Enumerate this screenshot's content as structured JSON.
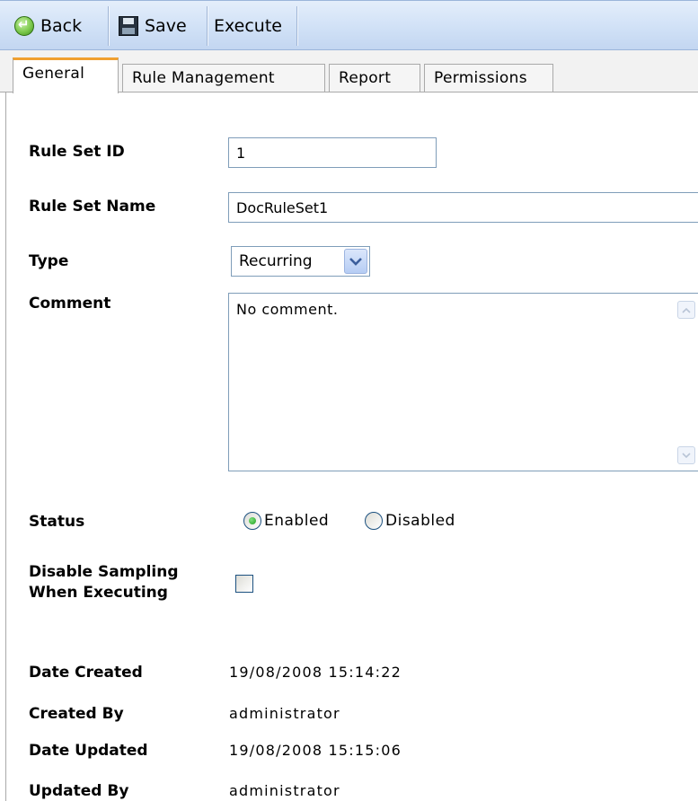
{
  "toolbar": {
    "back_label": "Back",
    "save_label": "Save",
    "execute_label": "Execute"
  },
  "tabs": [
    {
      "label": "General",
      "active": true
    },
    {
      "label": "Rule Management",
      "active": false
    },
    {
      "label": "Report",
      "active": false
    },
    {
      "label": "Permissions",
      "active": false
    }
  ],
  "form": {
    "rule_set_id_label": "Rule Set ID",
    "rule_set_id_value": "1",
    "rule_set_name_label": "Rule Set Name",
    "rule_set_name_value": "DocRuleSet1",
    "type_label": "Type",
    "type_value": "Recurring",
    "comment_label": "Comment",
    "comment_value": "No comment.",
    "status_label": "Status",
    "status_options": [
      {
        "label": "Enabled",
        "selected": true
      },
      {
        "label": "Disabled",
        "selected": false
      }
    ],
    "disable_sampling_label_line1": "Disable Sampling",
    "disable_sampling_label_line2": "When Executing",
    "disable_sampling_checked": false
  },
  "info": {
    "date_created_label": "Date Created",
    "date_created_value": "19/08/2008 15:14:22",
    "created_by_label": "Created By",
    "created_by_value": "administrator",
    "date_updated_label": "Date Updated",
    "date_updated_value": "19/08/2008 15:15:06",
    "updated_by_label": "Updated By",
    "updated_by_value": "administrator"
  },
  "colors": {
    "toolbar_bg": "#cfe0f6",
    "active_tab_accent": "#f0a030",
    "input_border": "#7f9db9"
  },
  "icons": {
    "back": "back-arrow-icon",
    "save": "floppy-disk-icon"
  }
}
